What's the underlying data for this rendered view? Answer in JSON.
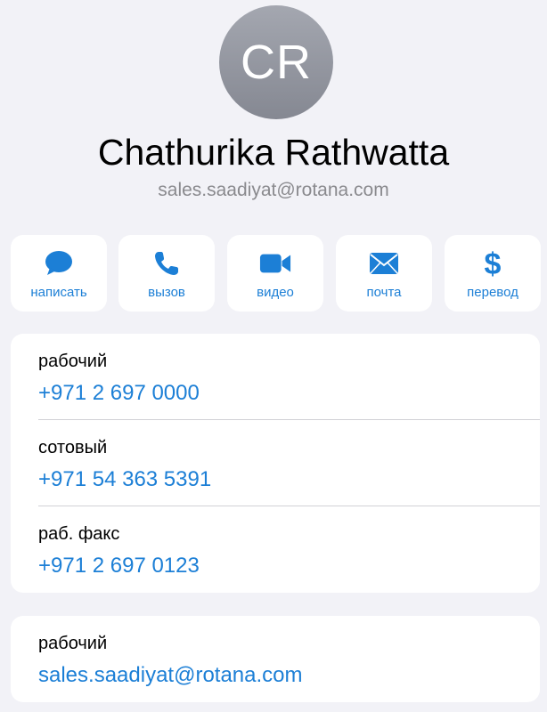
{
  "contact": {
    "initials": "CR",
    "name": "Chathurika Rathwatta",
    "subtitle": "sales.saadiyat@rotana.com"
  },
  "actions": [
    {
      "label": "написать",
      "icon": "message-bubble-icon"
    },
    {
      "label": "вызов",
      "icon": "phone-icon"
    },
    {
      "label": "видео",
      "icon": "video-camera-icon"
    },
    {
      "label": "почта",
      "icon": "envelope-icon"
    },
    {
      "label": "перевод",
      "icon": "dollar-icon"
    }
  ],
  "phones": [
    {
      "label": "рабочий",
      "value": "+971 2 697 0000"
    },
    {
      "label": "сотовый",
      "value": "+971 54 363 5391"
    },
    {
      "label": "раб. факс",
      "value": "+971 2 697 0123"
    }
  ],
  "email": {
    "label": "рабочий",
    "value": "sales.saadiyat@rotana.com"
  },
  "colors": {
    "accent": "#1c7fd6",
    "background": "#f2f2f7",
    "card": "#ffffff",
    "avatar": "#9a9ca5"
  }
}
